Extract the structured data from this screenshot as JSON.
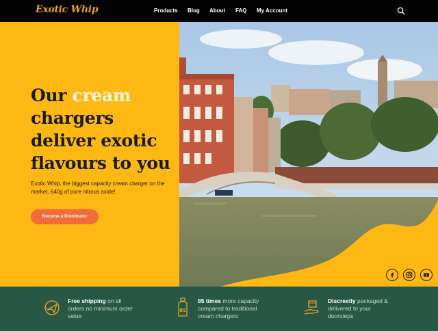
{
  "nav": {
    "logo": "Exotic Whip",
    "links": [
      "Products",
      "Blog",
      "About",
      "FAQ",
      "My Account"
    ],
    "search_icon": "search-icon"
  },
  "hero": {
    "title_part1": "Our ",
    "title_highlight": "cream",
    "title_part2": " chargers deliver exotic flavours to you",
    "subtitle": "Exotic Whip, the biggest capacity cream charger on the market, 640g of pure nitrous oxide!",
    "cta_label": "Become a Distributor"
  },
  "social": [
    "facebook-icon",
    "instagram-icon",
    "youtube-icon"
  ],
  "features": [
    {
      "icon": "delivery-plane-icon",
      "bold": "Free shipping",
      "rest": " on all orders no minimum order value"
    },
    {
      "icon": "canister-icon",
      "icon_label": "85",
      "bold": "85 times",
      "rest": " more capacity compared to traditional cream chargers"
    },
    {
      "icon": "package-hand-icon",
      "bold": "Discreetly",
      "rest": " packaged & delivered to your doorsteps"
    }
  ],
  "colors": {
    "brand_yellow": "#fdb813",
    "cta_orange": "#f26b3a",
    "footer_green": "#275846",
    "nav_black": "#030303"
  }
}
